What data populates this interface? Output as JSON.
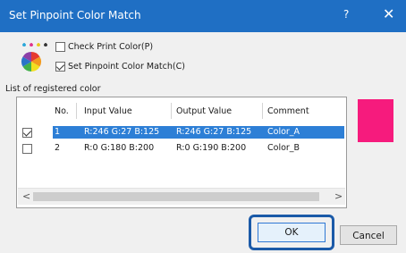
{
  "window": {
    "title": "Set Pinpoint Color Match",
    "help_glyph": "?",
    "close_glyph": "✕"
  },
  "options": {
    "check_print_color": {
      "label": "Check Print Color(P)",
      "checked": false
    },
    "set_pinpoint": {
      "label": "Set Pinpoint Color Match(C)",
      "checked": true
    }
  },
  "list": {
    "title": "List of registered color",
    "columns": [
      "No.",
      "Input Value",
      "Output Value",
      "Comment"
    ],
    "rows": [
      {
        "checked": true,
        "no": "1",
        "input": "R:246 G:27 B:125",
        "output": "R:246 G:27 B:125",
        "comment": "Color_A",
        "selected": true
      },
      {
        "checked": false,
        "no": "2",
        "input": "R:0 G:180 B:200",
        "output": "R:0 G:190 B:200",
        "comment": "Color_B",
        "selected": false
      }
    ],
    "scroll_left": "<",
    "scroll_right": ">"
  },
  "swatch_color": "#f61b7d",
  "buttons": {
    "ok": "OK",
    "cancel": "Cancel"
  }
}
